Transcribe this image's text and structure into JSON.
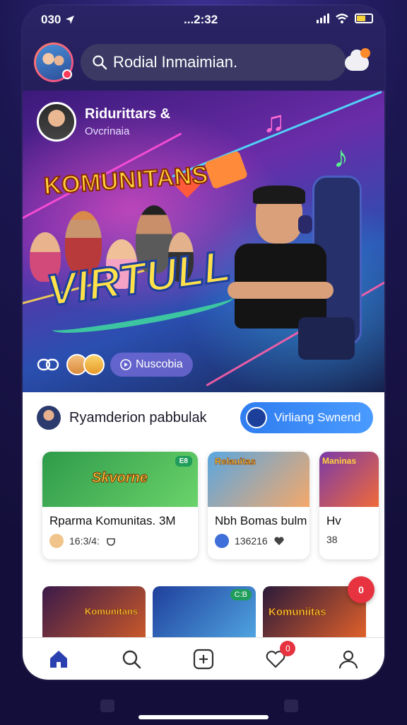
{
  "status": {
    "time_left": "030",
    "time_mid": "...2:32"
  },
  "header": {
    "search_text": "Rodial Inmaimian."
  },
  "hero": {
    "user_name": "Ridurittars &",
    "user_sub": "Ovcrinaia",
    "title_line1": "KOMUNITANS",
    "title_line2": "VIRTULL",
    "pill_label": "Nuscobia"
  },
  "promo": {
    "label": "Ryamderion pabbulak",
    "cta_label": "Virliang Swnend"
  },
  "cards": [
    {
      "title": "Rparma Komunitas. 3M",
      "meta": "16:3/4:",
      "tag": "E8",
      "thumb_color": "#2e9b4a",
      "thumb_text": "Skvorne"
    },
    {
      "title": "Nbh Bomas bulm",
      "meta": "136216",
      "tag": "",
      "thumb_color": "#5aa7e0",
      "thumb_text": "Relauitas"
    },
    {
      "title": "Hv",
      "meta": "38",
      "tag": "",
      "thumb_color": "#7a3aa8",
      "thumb_text": "Maninas"
    }
  ],
  "row2": [
    {
      "label": "Komunitans",
      "tag": "",
      "color": "#5a2a1a"
    },
    {
      "label": "",
      "tag": "C:B",
      "color": "#2a5fb0"
    },
    {
      "label": "Komuniitas",
      "tag": "",
      "color": "#b04a1a"
    }
  ],
  "fab_label": "0",
  "nav": [
    {
      "name": "home"
    },
    {
      "name": "search"
    },
    {
      "name": "add"
    },
    {
      "name": "likes",
      "badge": "0"
    },
    {
      "name": "profile"
    }
  ],
  "colors": {
    "accent": "#2f7df0",
    "nav_active": "#2a3fb0",
    "badge": "#e6333f"
  }
}
